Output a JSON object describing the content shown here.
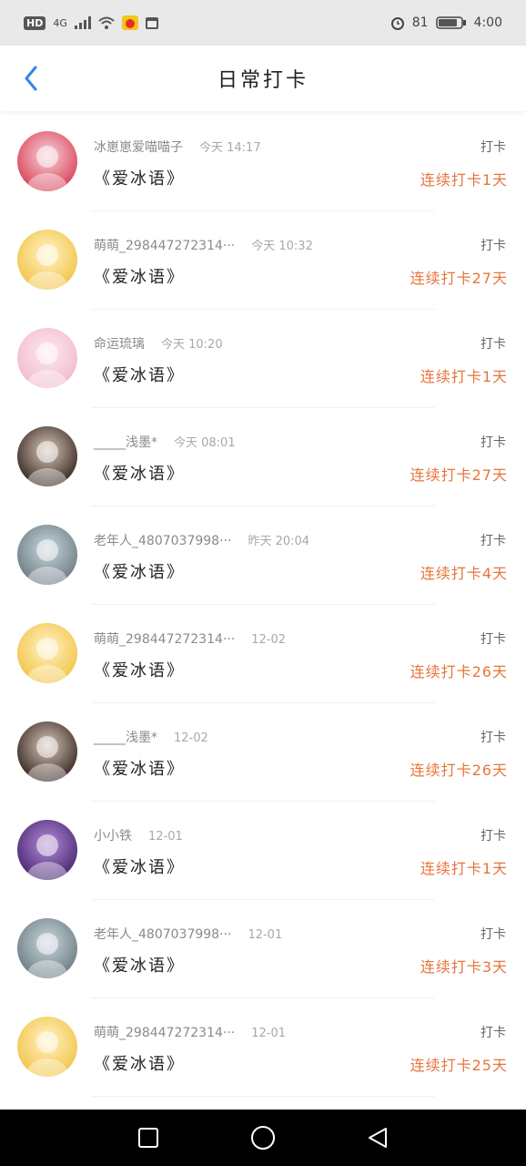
{
  "status_bar": {
    "network": "HD",
    "signal": "4G",
    "battery": "81",
    "time": "4:00"
  },
  "header": {
    "title": "日常打卡"
  },
  "list": [
    {
      "user": "冰崽崽爱喵喵子",
      "time": "今天 14:17",
      "book": "《爱冰语》",
      "tag": "打卡",
      "streak": "连续打卡1天",
      "avatar": {
        "bg1": "#f7d3d9",
        "bg2": "#d9475c"
      }
    },
    {
      "user": "萌萌_2984472723​14···",
      "time": "今天 10:32",
      "book": "《爱冰语》",
      "tag": "打卡",
      "streak": "连续打卡27天",
      "avatar": {
        "bg1": "#fff3c6",
        "bg2": "#f3c54a"
      }
    },
    {
      "user": "命运琉璃",
      "time": "今天 10:20",
      "book": "《爱冰语》",
      "tag": "打卡",
      "streak": "连续打卡1天",
      "avatar": {
        "bg1": "#fde9ef",
        "bg2": "#f2bccb"
      }
    },
    {
      "user": "_____浅墨*",
      "time": "今天 08:01",
      "book": "《爱冰语》",
      "tag": "打卡",
      "streak": "连续打卡27天",
      "avatar": {
        "bg1": "#d8c7b9",
        "bg2": "#3a2b25"
      }
    },
    {
      "user": "老年人_4807037998···",
      "time": "昨天 20:04",
      "book": "《爱冰语》",
      "tag": "打卡",
      "streak": "连续打卡4天",
      "avatar": {
        "bg1": "#c9d6dd",
        "bg2": "#6f7f86"
      }
    },
    {
      "user": "萌萌_2984472723​14···",
      "time": "12-02",
      "book": "《爱冰语》",
      "tag": "打卡",
      "streak": "连续打卡26天",
      "avatar": {
        "bg1": "#fff3c6",
        "bg2": "#f3c54a"
      }
    },
    {
      "user": "_____浅墨*",
      "time": "12-02",
      "book": "《爱冰语》",
      "tag": "打卡",
      "streak": "连续打卡26天",
      "avatar": {
        "bg1": "#d8c7b9",
        "bg2": "#3a2b25"
      }
    },
    {
      "user": "小小铁",
      "time": "12-01",
      "book": "《爱冰语》",
      "tag": "打卡",
      "streak": "连续打卡1天",
      "avatar": {
        "bg1": "#b68bd6",
        "bg2": "#4b2a76"
      }
    },
    {
      "user": "老年人_4807037998···",
      "time": "12-01",
      "book": "《爱冰语》",
      "tag": "打卡",
      "streak": "连续打卡3天",
      "avatar": {
        "bg1": "#c9d6dd",
        "bg2": "#6f7f86"
      }
    },
    {
      "user": "萌萌_2984472723​14···",
      "time": "12-01",
      "book": "《爱冰语》",
      "tag": "打卡",
      "streak": "连续打卡25天",
      "avatar": {
        "bg1": "#fff3c6",
        "bg2": "#f3c54a"
      }
    }
  ],
  "colors": {
    "accent": "#2f86ea",
    "streak": "#e8743b"
  },
  "icons": {
    "back": "chevron-left-icon",
    "recent": "square-icon",
    "home": "circle-icon",
    "nav_back": "triangle-left-icon"
  }
}
